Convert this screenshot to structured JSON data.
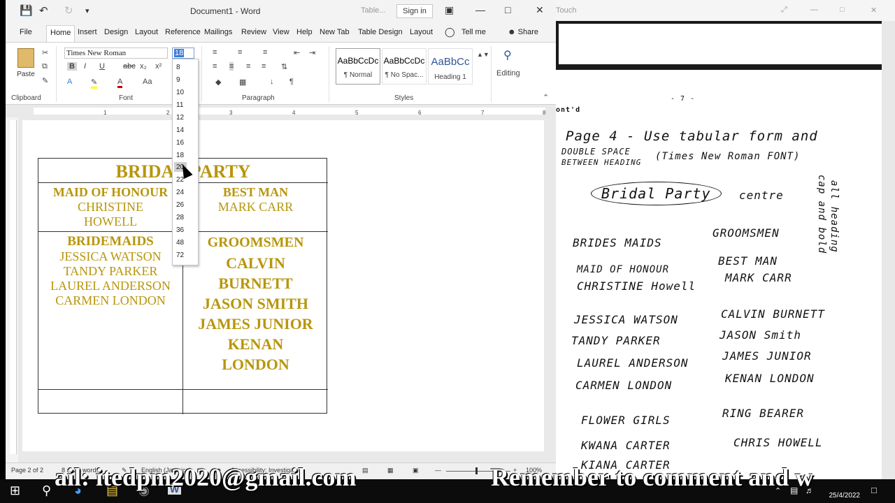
{
  "word": {
    "title": "Document1 - Word",
    "context_tab": "Table...",
    "sign_in": "Sign in",
    "tabs": [
      "File",
      "Home",
      "Insert",
      "Design",
      "Layout",
      "Reference",
      "Mailings",
      "Review",
      "View",
      "Help",
      "New Tab",
      "Table Design",
      "Layout",
      "Tell me",
      "Share"
    ],
    "ribbon": {
      "paste_label": "Paste",
      "font_name": "Times New Roman",
      "font_size": "18",
      "group_clipboard": "Clipboard",
      "group_font": "Font",
      "group_paragraph": "Paragraph",
      "group_styles": "Styles",
      "editing_label": "Editing",
      "styles": [
        {
          "preview": "AaBbCcDc",
          "name": "¶ Normal"
        },
        {
          "preview": "AaBbCcDc",
          "name": "¶ No Spac..."
        },
        {
          "preview": "AaBbCc",
          "name": "Heading 1"
        }
      ]
    },
    "font_size_options": [
      "8",
      "9",
      "10",
      "11",
      "12",
      "14",
      "16",
      "18",
      "20",
      "22",
      "24",
      "26",
      "28",
      "36",
      "48",
      "72"
    ],
    "ruler_numbers": [
      "1",
      "2",
      "3",
      "4",
      "5",
      "6",
      "7",
      "8"
    ],
    "table": {
      "title": "BRIDAL PARTY",
      "maid_head": "MAID OF HONOUR",
      "maid_name": "CHRISTINE HOWELL",
      "bestman_head": "BEST MAN",
      "bestman_name": "MARK CARR",
      "bridesmaids_head": "BRIDEMAIDS",
      "bridesmaids": [
        "JESSICA WATSON",
        "TANDY PARKER",
        "LAUREL ANDERSON",
        "CARMEN LONDON"
      ],
      "groomsmen_head": "GROOMSMEN",
      "groomsmen": [
        "CALVIN",
        "BURNETT",
        "JASON SMITH",
        "JAMES JUNIOR",
        "KENAN",
        "LONDON"
      ]
    },
    "status": {
      "page": "Page 2 of 2",
      "words": "8 of 33 words",
      "language": "English (Jamaica)",
      "accessibility": "Accessibility: Investigate",
      "zoom": "100%"
    }
  },
  "right_doc": {
    "window_title": "Touch",
    "page_number": "- 7 -",
    "contd": "ont'd",
    "lines": [
      "Page 4  -  Use tabular form and",
      "DOUBLE SPACE",
      "BETWEEN HEADING",
      "(Times New Roman FONT)",
      "Bridal Party",
      "centre",
      "cap and bold",
      "all heading",
      "BRIDES MAIDS",
      "GROOMSMEN",
      "MAID OF HONOUR",
      "BEST MAN",
      "CHRISTINE Howell",
      "MARK CARR",
      "JESSICA WATSON",
      "CALVIN BURNETT",
      "TANDY PARKER",
      "JASON Smith",
      "LAUREL ANDERSON",
      "JAMES JUNIOR",
      "CARMEN LONDON",
      "KENAN LONDON",
      "FLOWER GIRLS",
      "RING BEARER",
      "KWANA CARTER",
      "CHRIS HOWELL",
      "KIANA CARTER"
    ]
  },
  "overlay": {
    "email": "ail: itedpm2020@gmail.com",
    "reminder": "Remember to comment and w"
  },
  "taskbar": {
    "date": "25/4/2022"
  }
}
